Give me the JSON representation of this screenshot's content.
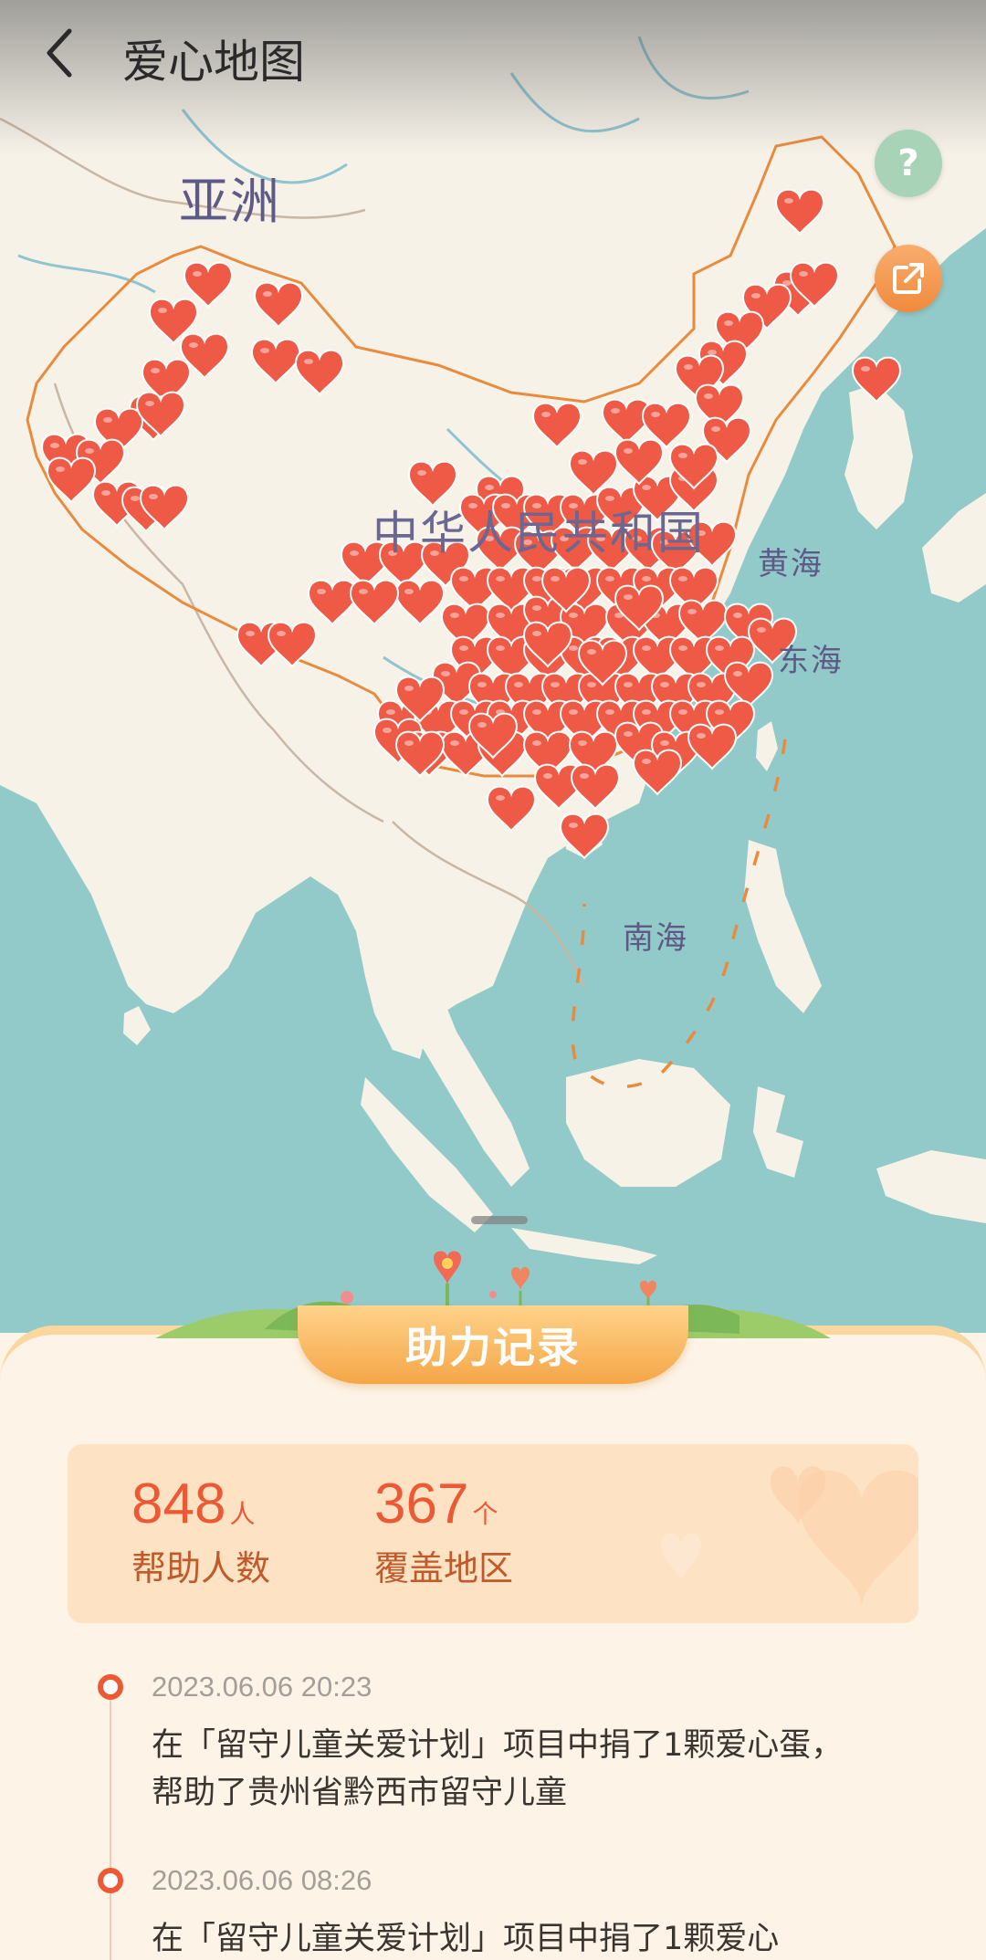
{
  "header": {
    "title": "爱心地图"
  },
  "map": {
    "labels": {
      "asia": "亚洲",
      "china": "中华人民共和国",
      "yellow_sea": "黄海",
      "east_sea": "东海",
      "south_sea": "南海"
    }
  },
  "panel": {
    "tab_label": "助力记录"
  },
  "stats": [
    {
      "value": "848",
      "unit": "人",
      "label": "帮助人数"
    },
    {
      "value": "367",
      "unit": "个",
      "label": "覆盖地区"
    }
  ],
  "records": [
    {
      "time": "2023.06.06 20:23",
      "text": "在「留守儿童关爱计划」项目中捐了1颗爱心蛋，帮助了贵州省黔西市留守儿童"
    },
    {
      "time": "2023.06.06 08:26",
      "text": "在「留守儿童关爱计划」项目中捐了1颗爱心"
    }
  ],
  "colors": {
    "heart": "#ee5a45",
    "accent": "#ec5a35",
    "tab": "#f5a648",
    "help": "#a9d3b6",
    "share": "#f08a3d"
  },
  "icons": {
    "back": "chevron-left-icon",
    "help": "question-icon",
    "share": "share-icon",
    "heart": "heart-icon"
  }
}
